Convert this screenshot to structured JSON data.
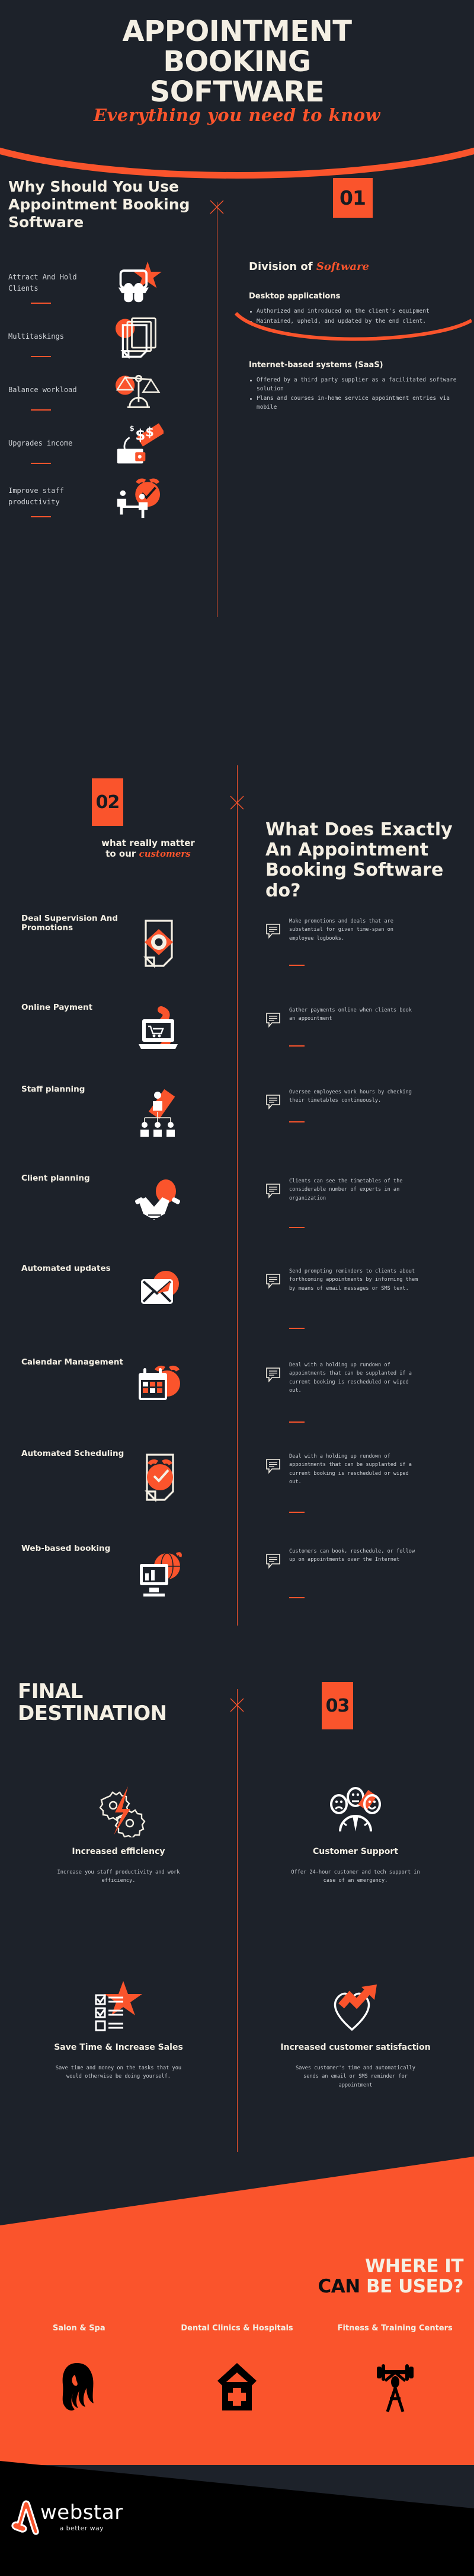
{
  "colors": {
    "background": "#1d222a",
    "accent": "#fa542c",
    "cream": "#f4efe3",
    "body_text": "#c8ccd1",
    "footer_bg": "#000000"
  },
  "hero": {
    "line1": "APPOINTMENT",
    "line2": "BOOKING",
    "line3": "SOFTWARE",
    "subtitle": "Everything you need to know"
  },
  "section01": {
    "number": "01",
    "heading": "Why Should You Use Appointment Booking Software",
    "benefits": [
      {
        "label": "Attract And Hold Clients",
        "icon": "clients-star-icon"
      },
      {
        "label": "Multitaskings",
        "icon": "stacked-documents-icon"
      },
      {
        "label": "Balance workload",
        "icon": "balance-scale-icon"
      },
      {
        "label": "Upgrades income",
        "icon": "money-wallet-icon"
      },
      {
        "label": "Improve staff productivity",
        "icon": "staff-clock-icon"
      }
    ],
    "division_title_plain": "Division of",
    "division_title_script": "Software",
    "groups": [
      {
        "title": "Desktop applications",
        "bullets": [
          "Authorized and introduced on the client's equipment",
          "Maintained, upheld, and updated by the end client."
        ]
      },
      {
        "title": "Internet-based systems (SaaS)",
        "bullets": [
          "Offered by a third party supplier as a facilitated software solution",
          "Plans and courses in-home service appointment entries via mobile"
        ]
      }
    ]
  },
  "section02": {
    "number": "02",
    "kicker_line1": "what really matter",
    "kicker_line2_plain": "to our",
    "kicker_line2_script": "customers",
    "heading": "What Does Exactly An Appointment Booking Software do?",
    "features": [
      {
        "title": "Deal Supervision And Promotions",
        "icon": "document-eye-icon",
        "desc": "Make promotions and deals that are substantial for given time-span on employee logbooks."
      },
      {
        "title": "Online Payment",
        "icon": "laptop-cart-icon",
        "desc": "Gather payments online when clients book an appointment"
      },
      {
        "title": "Staff planning",
        "icon": "org-chart-icon",
        "desc": "Oversee employees work hours by checking their timetables continuously."
      },
      {
        "title": "Client planning",
        "icon": "handshake-icon",
        "desc": "Clients can see the timetables of the considerable number of experts in an organization"
      },
      {
        "title": "Automated updates",
        "icon": "envelope-icon",
        "desc": "Send prompting reminders to clients about forthcoming appointments by informing them by means of email messages or SMS text."
      },
      {
        "title": "Calendar Management",
        "icon": "calendar-alarm-icon",
        "desc": "Deal with a holding up rundown of appointments that can be supplanted if a current booking is rescheduled or wiped out."
      },
      {
        "title": "Automated Scheduling",
        "icon": "document-alarm-icon",
        "desc": "Deal with a holding up rundown of appointments that can be supplanted if a current booking is rescheduled or wiped out."
      },
      {
        "title": "Web-based booking",
        "icon": "monitor-globe-icon",
        "desc": "Customers can book, reschedule, or follow up on appointments over the Internet"
      }
    ]
  },
  "section03": {
    "number": "03",
    "heading_line1": "FINAL",
    "heading_line2": "DESTINATION",
    "benefits": [
      {
        "title": "Increased efficiency",
        "icon": "gears-bolt-icon",
        "desc": "Increase you staff productivity and work efficiency."
      },
      {
        "title": "Customer Support",
        "icon": "satisfaction-meter-icon",
        "desc": "Offer 24-hour customer and tech support in case of an emergency."
      },
      {
        "title": "Save Time & Increase Sales",
        "icon": "checklist-star-icon",
        "desc": "Save time and money on the tasks that you would otherwise be doing yourself."
      },
      {
        "title": "Increased customer satisfaction",
        "icon": "heart-arrow-icon",
        "desc": "Saves customer's time and automatically sends an email or SMS reminder for appointment"
      }
    ]
  },
  "where_used": {
    "title_part1": "WHERE IT",
    "title_part2_dark": "CAN",
    "title_part2_cream": "BE USED?",
    "items": [
      {
        "label": "Salon & Spa",
        "icon": "hair-salon-icon"
      },
      {
        "label": "Dental Clinics & Hospitals",
        "icon": "hospital-icon"
      },
      {
        "label": "Fitness & Training Centers",
        "icon": "weightlifter-icon"
      }
    ]
  },
  "footer": {
    "brand": "webstar",
    "tagline": "a better way"
  }
}
